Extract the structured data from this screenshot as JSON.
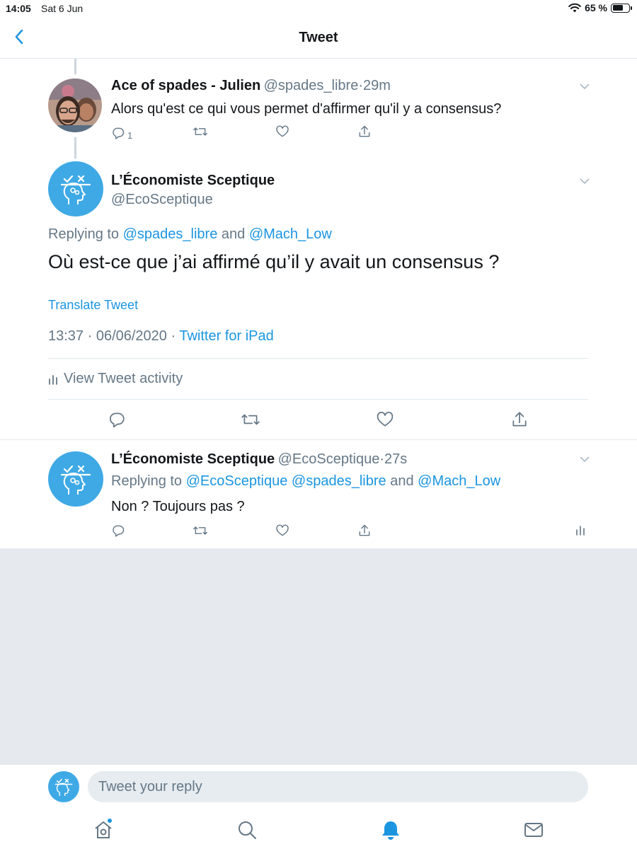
{
  "status_bar": {
    "time": "14:05",
    "date": "Sat 6 Jun",
    "battery": "65 %",
    "battery_level": 0.65
  },
  "nav": {
    "title": "Tweet"
  },
  "parent_tweet": {
    "name": "Ace of spades - Julien",
    "handle": "@spades_libre",
    "time": "29m",
    "text": "Alors qu'est ce qui vous permet d'affirmer qu'il y a consensus?",
    "reply_count": "1"
  },
  "main_tweet": {
    "name": "L’Économiste Sceptique",
    "handle": "@EcoSceptique",
    "replying_prefix": "Replying to",
    "replying_to_1": "@spades_libre",
    "replying_and": "and",
    "replying_to_2": "@Mach_Low",
    "text": "Où est-ce que j’ai affirmé qu’il y avait un consensus ?",
    "translate": "Translate Tweet",
    "timestamp": "13:37 · 06/06/2020 ·",
    "source": "Twitter for iPad",
    "activity": "View Tweet activity"
  },
  "reply_tweet": {
    "name": "L’Économiste Sceptique",
    "handle": "@EcoSceptique",
    "time": "27s",
    "replying_prefix": "Replying to",
    "replying_to_1": "@EcoSceptique",
    "replying_to_2": "@spades_libre",
    "replying_and": "and",
    "replying_to_3": "@Mach_Low",
    "text": "Non ? Toujours pas ?"
  },
  "compose": {
    "placeholder": "Tweet your reply"
  },
  "colors": {
    "accent": "#1b95e0",
    "avatar_bg": "#3fa9e6",
    "muted": "#657786",
    "background_empty": "#e6e9ed"
  },
  "icons": [
    "back-chevron-icon",
    "reply-icon",
    "retweet-icon",
    "like-icon",
    "share-icon",
    "analytics-icon",
    "home-icon",
    "search-icon",
    "notifications-icon",
    "messages-icon",
    "wifi-icon",
    "battery-icon"
  ]
}
